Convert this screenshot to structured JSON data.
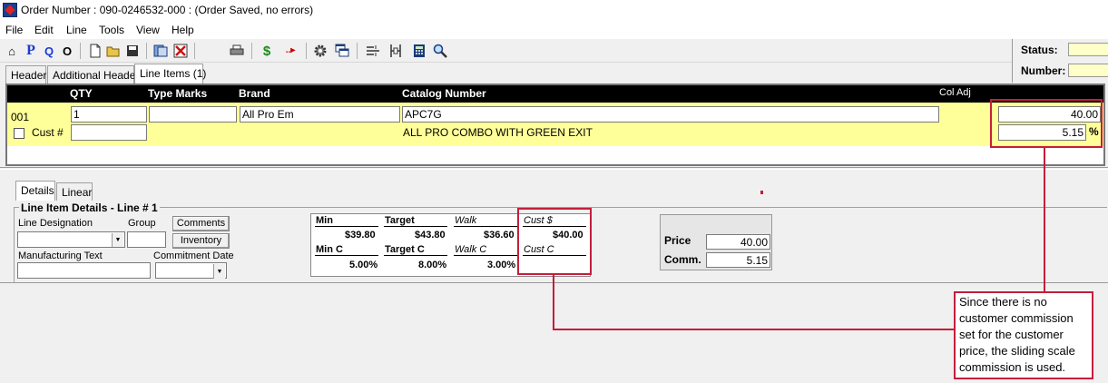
{
  "window": {
    "title": "Order Number : 090-0246532-000 : (Order Saved, no errors)"
  },
  "menu": [
    "File",
    "Edit",
    "Line",
    "Tools",
    "View",
    "Help"
  ],
  "toolbar": {
    "icons": [
      "home-icon",
      "p-icon",
      "q-icon",
      "o-icon",
      "new-doc-icon",
      "open-folder-icon",
      "save-icon",
      "copy-icon",
      "delete-icon",
      "print-icon",
      "dollar-icon",
      "more-icon",
      "settings-icon",
      "windows-icon",
      "split-icon",
      "merge-icon",
      "calculator-icon",
      "search-icon"
    ],
    "glyphs": {
      "home": "⌂",
      "p": "P",
      "q": "Q",
      "o": "O",
      "dollar": "$",
      "more": "..▸",
      "calc": "▦",
      "search": "⌕"
    }
  },
  "status": {
    "status_label": "Status:",
    "number_label": "Number:",
    "status_value": "",
    "number_value": ""
  },
  "tabs": [
    "Header",
    "Additional Header",
    "Line Items (1)"
  ],
  "line_header": {
    "qty": "QTY",
    "type_marks": "Type Marks",
    "brand": "Brand",
    "catalog": "Catalog Number",
    "col_adj": "Col Adj"
  },
  "line": {
    "number": "001",
    "qty": "1",
    "type_marks": "",
    "brand": "All Pro Em",
    "catalog": "APC7G",
    "description": "ALL PRO COMBO WITH GREEN EXIT",
    "cust_label": "Cust #",
    "cust_value": "",
    "col_price": "40.00",
    "col_comm": "5.15",
    "percent": "%"
  },
  "sub_tabs": [
    "Details",
    "Linear"
  ],
  "details": {
    "group_title": "Line Item Details - Line # 1",
    "line_designation_label": "Line Designation",
    "group_label": "Group",
    "comments_button": "Comments",
    "inventory_button": "Inventory",
    "mfg_text_label": "Manufacturing Text",
    "commitment_date_label": "Commitment Date"
  },
  "pricing": {
    "min": "Min",
    "target": "Target",
    "walk": "Walk",
    "cust_dollar": "Cust $",
    "min_val": "$39.80",
    "target_val": "$43.80",
    "walk_val": "$36.60",
    "cust_val": "$40.00",
    "min_c": "Min C",
    "target_c": "Target C",
    "walk_c": "Walk C",
    "cust_c": "Cust C",
    "min_c_val": "5.00%",
    "target_c_val": "8.00%",
    "walk_c_val": "3.00%",
    "cust_c_val": ""
  },
  "price_comm": {
    "price_label": "Price",
    "price_value": "40.00",
    "comm_label": "Comm.",
    "comm_value": "5.15"
  },
  "callout": {
    "text": "Since there is no customer commission set for the customer price, the sliding scale commission is used."
  },
  "colors": {
    "highlight": "#ffff99",
    "annotation": "#c41e3a",
    "header_bg": "#000000"
  }
}
